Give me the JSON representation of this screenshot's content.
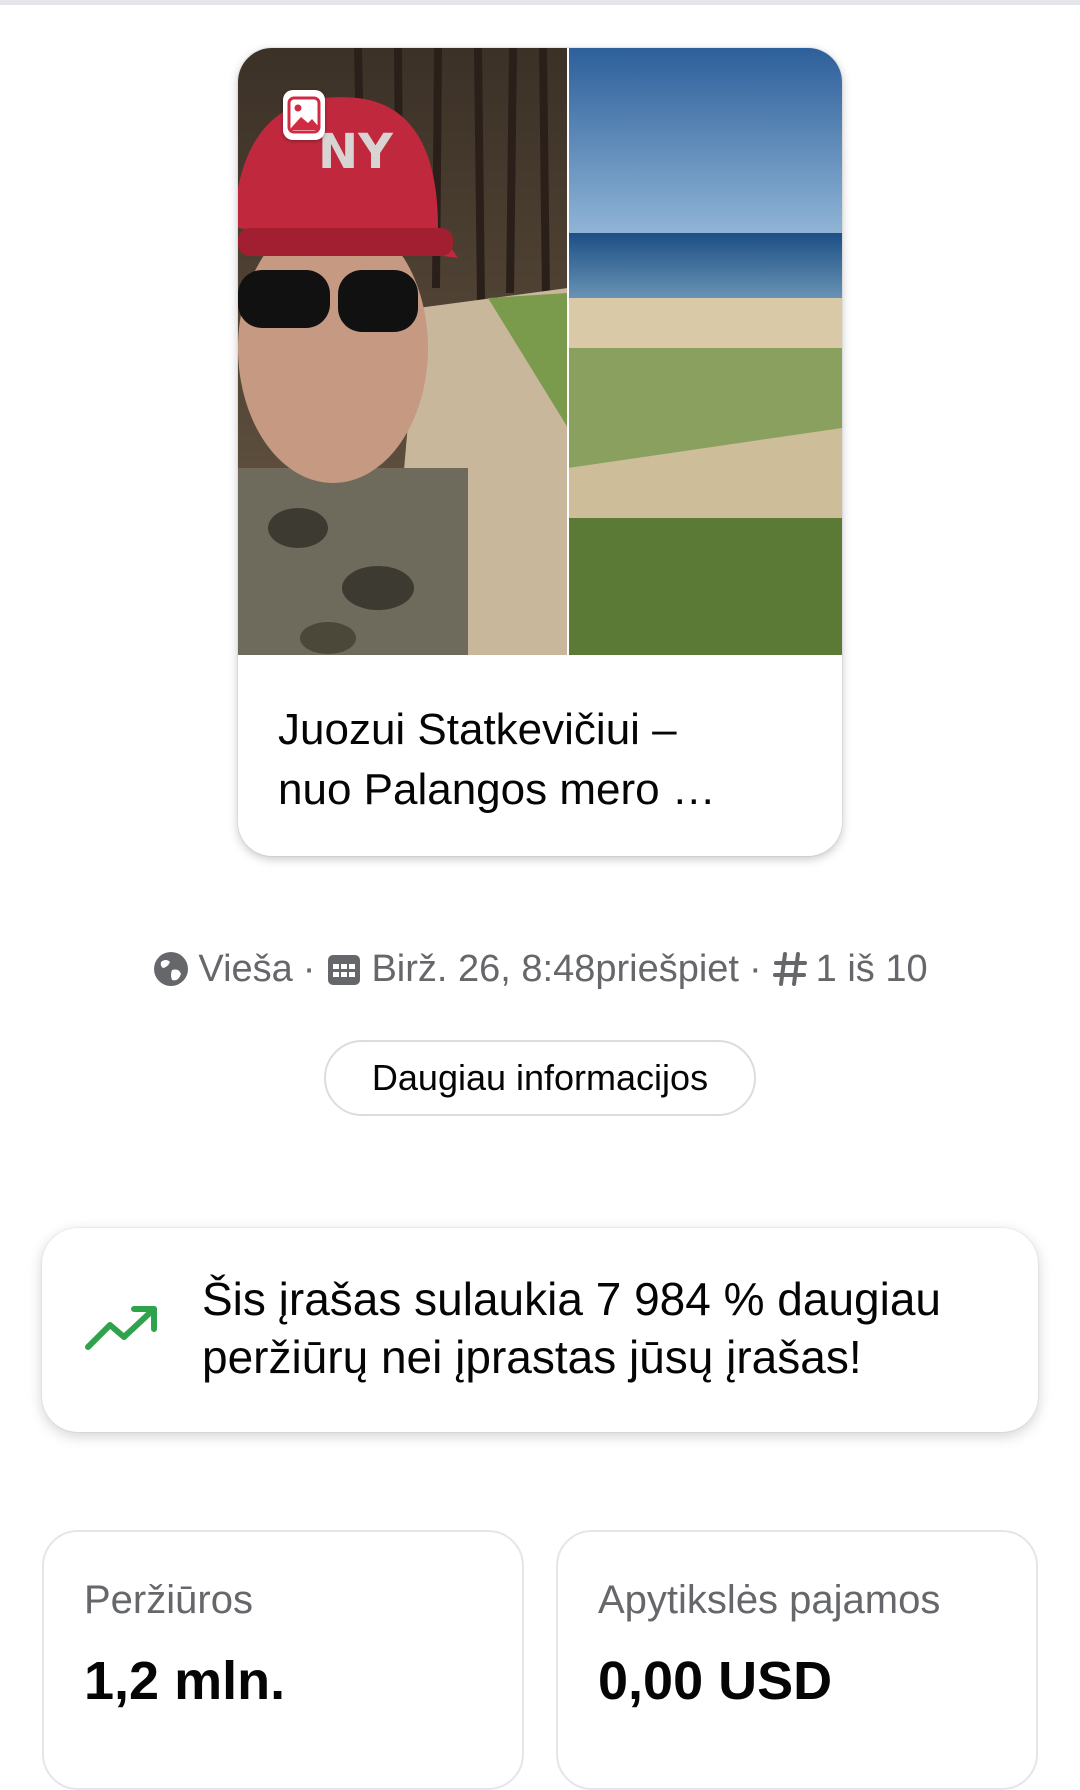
{
  "post": {
    "title": "Juozui Statkevičiui –\nnuo Palangos mero …",
    "image_badge_icon": "photo-icon"
  },
  "meta": {
    "audience_icon": "globe-icon",
    "audience": "Vieša",
    "date_icon": "calendar-icon",
    "date": "Birž. 26, 8:48priešpiet",
    "rank_icon": "hashtag-icon",
    "rank": "1 iš 10",
    "separator": "·"
  },
  "more_info_label": "Daugiau informacijos",
  "insight": {
    "icon": "trending-up-icon",
    "text": "Šis įrašas sulaukia 7 984 % daugiau peržiūrų nei įprastas jūsų įrašas!",
    "icon_color": "#31a24c"
  },
  "stats": [
    {
      "label": "Peržiūros",
      "value": "1,2 mln."
    },
    {
      "label": "Apytikslės pajamos",
      "value": "0,00 USD"
    }
  ]
}
